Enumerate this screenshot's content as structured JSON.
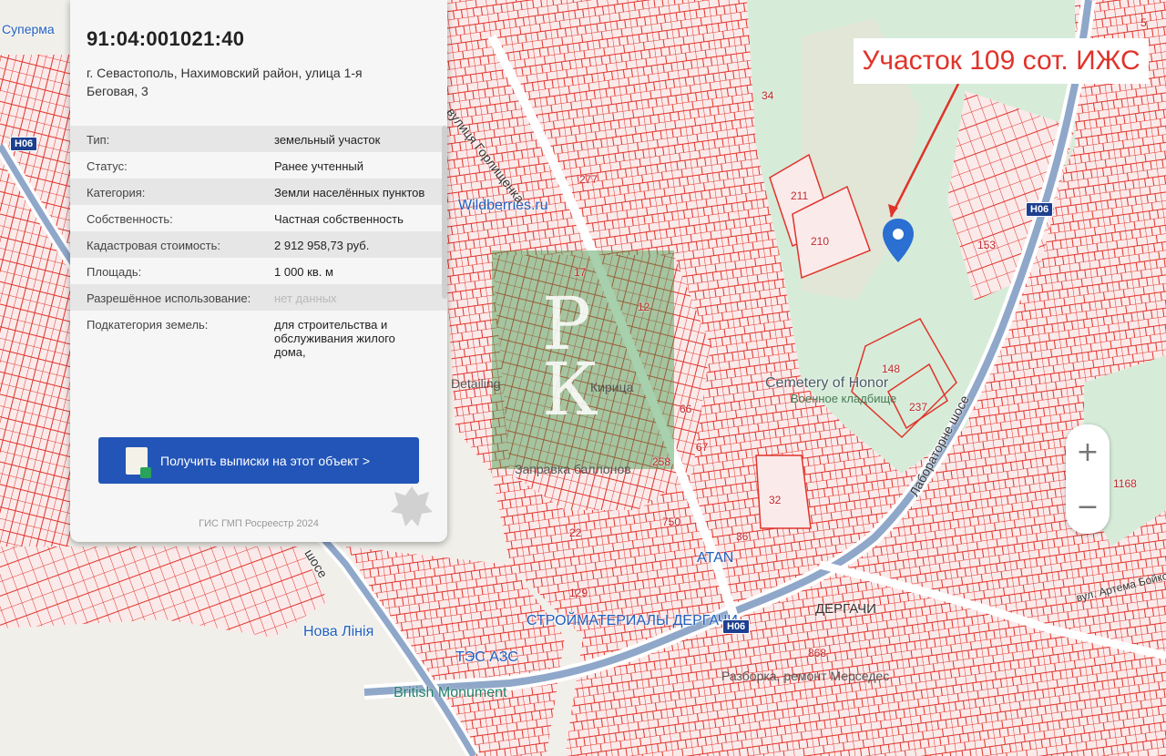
{
  "colors": {
    "parcel": "#e0332a",
    "panel_button": "#2355b8",
    "park": "#d6ecd9"
  },
  "callout": {
    "text": "Участок 109 сот. ИЖС"
  },
  "panel": {
    "cadastral_number": "91:04:001021:40",
    "address": "г. Севастополь, Нахимовский район, улица 1-я Беговая, 3",
    "attributes": [
      {
        "key": "Тип:",
        "value": "земельный участок"
      },
      {
        "key": "Статус:",
        "value": "Ранее учтенный"
      },
      {
        "key": "Категория:",
        "value": "Земли населённых пунктов"
      },
      {
        "key": "Собственность:",
        "value": "Частная собственность"
      },
      {
        "key": "Кадастровая стоимость:",
        "value": "2 912 958,73 руб."
      },
      {
        "key": "Площадь:",
        "value": "1 000 кв. м"
      },
      {
        "key": "Разрешённое использование:",
        "value": "нет данных"
      },
      {
        "key": "Подкатегория земель:",
        "value": "для строительства и обслуживания жилого дома,"
      }
    ],
    "button_label": "Получить выписки на этот объект >",
    "footer": "ГИС ГМП Росреестр 2024"
  },
  "map": {
    "pois": [
      "Wildberries.ru",
      "Cemetery of Honor",
      "Военное кладбище",
      "Заправка баллонов",
      "ATAN",
      "Нова Лінія",
      "ТЭС АЗС",
      "British Monument",
      "СТРОЙМАТЕРИАЛЫ ДЕРГАЧИ",
      "Разборка, ремонт Мерседес",
      "Кирица",
      "Detailing",
      "Суперма"
    ],
    "roads": [
      "вулиця Горлищенка",
      "Лабораторне шосе",
      "вул. Артема Бойко",
      "ДЕРГАЧИ",
      "шосе"
    ],
    "road_badges": [
      "Н06",
      "Н06",
      "Н06"
    ],
    "plot_numbers": [
      "34",
      "211",
      "210",
      "148",
      "237",
      "153",
      "32",
      "36",
      "66",
      "67",
      "258",
      "750",
      "129",
      "22",
      "868",
      "1168",
      "17",
      "12",
      "5",
      "277"
    ]
  },
  "zoom": {
    "in_label": "+",
    "out_label": "−"
  },
  "watermark": {
    "line1": "Р",
    "line2": "К"
  }
}
